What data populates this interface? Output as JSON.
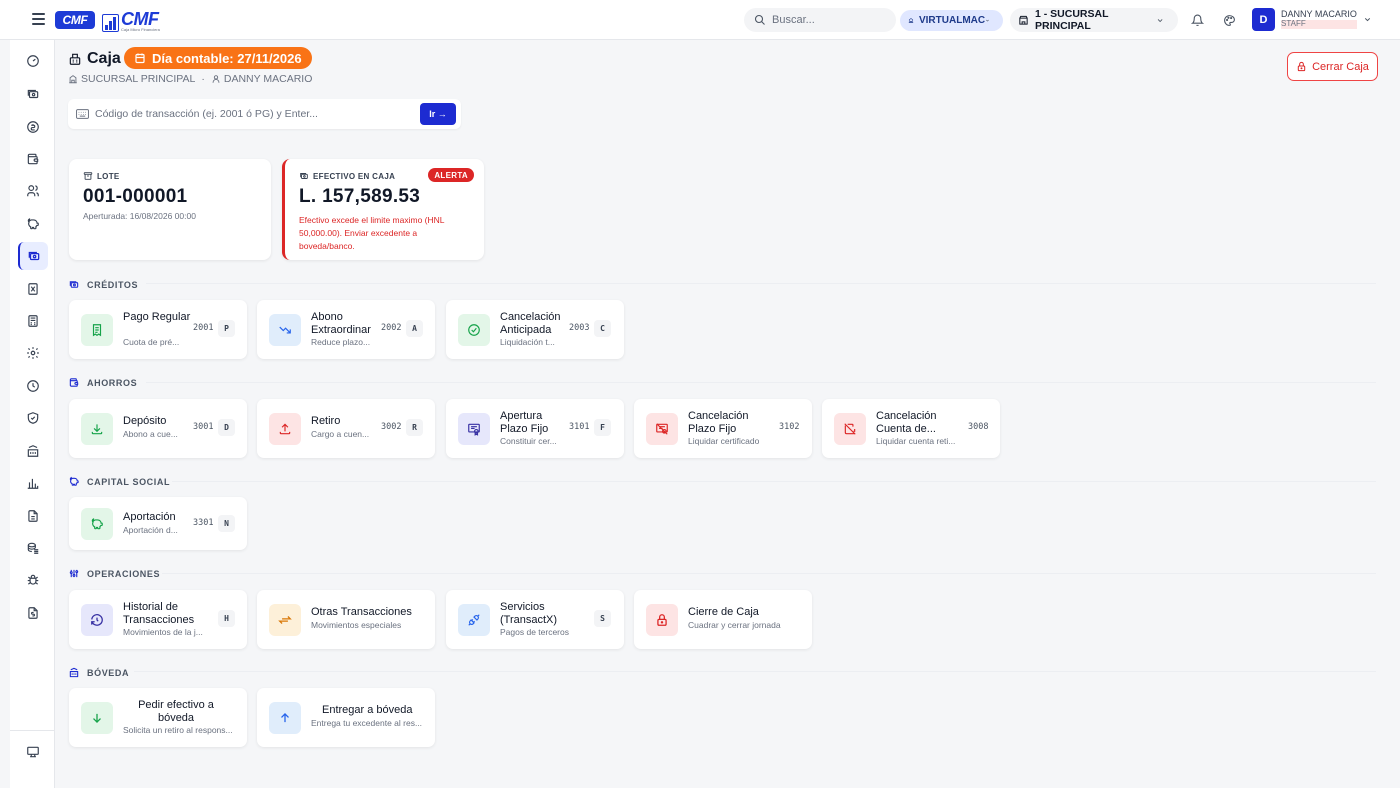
{
  "topbar": {
    "logo_badge": "CMF",
    "logo_text": "CMF",
    "logo_tagline": "Caja Micro Financiera",
    "search_placeholder": "Buscar...",
    "tenant": "VIRTUALMAC",
    "branch": "1 - SUCURSAL PRINCIPAL",
    "user_initial": "D",
    "user_name": "DANNY MACARIO",
    "user_role": "STAFF"
  },
  "header": {
    "title": "Caja",
    "day_badge": "Día contable: 27/11/2026",
    "branch": "SUCURSAL PRINCIPAL",
    "separator": "·",
    "user": "DANNY MACARIO",
    "close_button": "Cerrar Caja"
  },
  "transaction": {
    "placeholder": "Código de transacción (ej. 2001 ó PG) y Enter...",
    "go_button": "Ir →"
  },
  "stats": {
    "lote": {
      "label": "LOTE",
      "value": "001-000001",
      "detail": "Aperturada: 16/08/2026 00:00"
    },
    "cash": {
      "label": "EFECTIVO EN CAJA",
      "value": "L. 157,589.53",
      "badge": "ALERTA",
      "message": "Efectivo excede el limite maximo (HNL 50,000.00). Enviar excedente a boveda/banco.",
      "alert_color": "#dc2626"
    }
  },
  "sections": {
    "creditos": {
      "title": "CRÉDITOS",
      "cards": [
        {
          "title": "Pago Regular",
          "desc": "Cuota de pré...",
          "code": "2001",
          "key": "P",
          "icon": "receipt-icon"
        },
        {
          "title": "Abono Extraordinar",
          "desc": "Reduce plazo...",
          "code": "2002",
          "key": "A",
          "icon": "trending-down-icon"
        },
        {
          "title": "Cancelación Anticipada",
          "desc": "Liquidación t...",
          "code": "2003",
          "key": "C",
          "icon": "check-circle-icon"
        }
      ]
    },
    "ahorros": {
      "title": "AHORROS",
      "cards": [
        {
          "title": "Depósito",
          "desc": "Abono a cue...",
          "code": "3001",
          "key": "D",
          "icon": "download-icon"
        },
        {
          "title": "Retiro",
          "desc": "Cargo a cuen...",
          "code": "3002",
          "key": "R",
          "icon": "upload-icon"
        },
        {
          "title": "Apertura Plazo Fijo",
          "desc": "Constituir cer...",
          "code": "3101",
          "key": "F",
          "icon": "certificate-icon"
        },
        {
          "title": "Cancelación Plazo Fijo",
          "desc": "Liquidar certificado",
          "code": "3102",
          "key": "",
          "icon": "certificate-off-icon"
        },
        {
          "title": "Cancelación Cuenta de...",
          "desc": "Liquidar cuenta reti...",
          "code": "3008",
          "key": "",
          "icon": "wallet-off-icon"
        }
      ]
    },
    "capital": {
      "title": "CAPITAL SOCIAL",
      "cards": [
        {
          "title": "Aportación",
          "desc": "Aportación d...",
          "code": "3301",
          "key": "N",
          "icon": "piggy-bank-icon"
        }
      ]
    },
    "operaciones": {
      "title": "OPERACIONES",
      "cards": [
        {
          "title": "Historial de Transacciones",
          "desc": "Movimientos de la j...",
          "code": "",
          "key": "H",
          "icon": "history-icon"
        },
        {
          "title": "Otras Transacciones",
          "desc": "Movimientos especiales",
          "code": "",
          "key": "",
          "icon": "arrows-exchange-icon"
        },
        {
          "title": "Servicios (TransactX)",
          "desc": "Pagos de terceros",
          "code": "",
          "key": "S",
          "icon": "plug-icon"
        },
        {
          "title": "Cierre de Caja",
          "desc": "Cuadrar y cerrar jornada",
          "code": "",
          "key": "",
          "icon": "lock-icon"
        }
      ]
    },
    "boveda": {
      "title": "BÓVEDA",
      "cards": [
        {
          "title": "Pedir efectivo a bóveda",
          "desc": "Solicita un retiro al respons...",
          "code": "",
          "key": "",
          "icon": "arrow-down-icon"
        },
        {
          "title": "Entregar a bóveda",
          "desc": "Entrega tu excedente al res...",
          "code": "",
          "key": "",
          "icon": "arrow-up-icon"
        }
      ]
    }
  },
  "colors": {
    "primary": "#1d2bd1",
    "accent_orange": "#f97316",
    "danger": "#dc2626"
  }
}
